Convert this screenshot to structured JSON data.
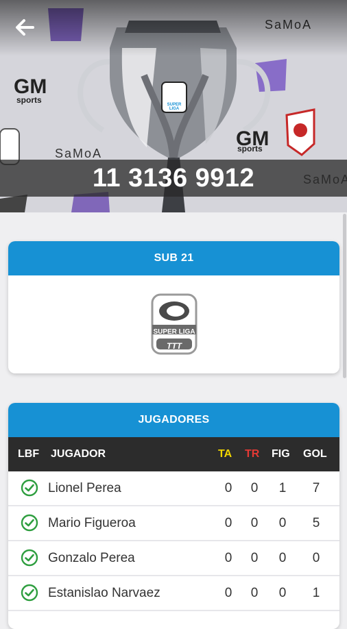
{
  "header": {
    "phone": "11 3136 9912"
  },
  "banner_texts": {
    "samoa": "SaMoA",
    "gm": "GM",
    "sports": "sports",
    "superliga": "SUPER LIGA"
  },
  "team_card": {
    "title": "SUB 21",
    "logo": {
      "line1": "SUPER LIGA",
      "line2": "TTT"
    }
  },
  "players": {
    "title": "JUGADORES",
    "columns": {
      "lbf": "LBF",
      "jugador": "JUGADOR",
      "ta": "TA",
      "tr": "TR",
      "fig": "FIG",
      "gol": "GOL"
    },
    "colors": {
      "ta": "#f2d600",
      "tr": "#e53935",
      "check": "#2e9e3f",
      "header_blue": "#1791d4"
    },
    "rows": [
      {
        "name": "Lionel Perea",
        "ta": "0",
        "tr": "0",
        "fig": "1",
        "gol": "7"
      },
      {
        "name": "Mario Figueroa",
        "ta": "0",
        "tr": "0",
        "fig": "0",
        "gol": "5"
      },
      {
        "name": "Gonzalo Perea",
        "ta": "0",
        "tr": "0",
        "fig": "0",
        "gol": "0"
      },
      {
        "name": "Estanislao Narvaez",
        "ta": "0",
        "tr": "0",
        "fig": "0",
        "gol": "1"
      }
    ]
  }
}
